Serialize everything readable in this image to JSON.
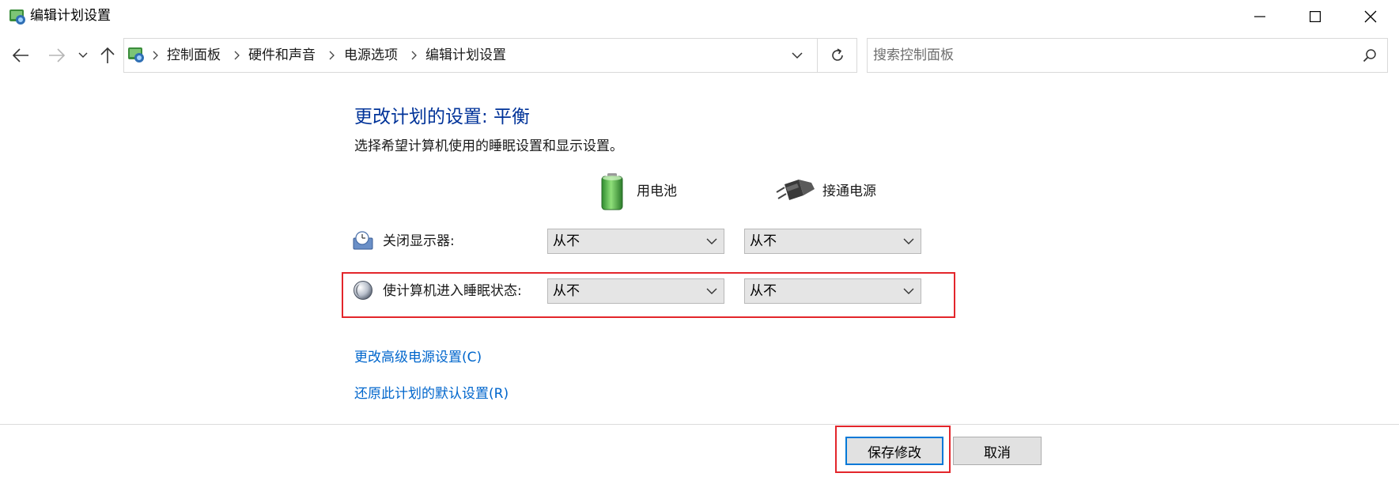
{
  "window": {
    "title": "编辑计划设置"
  },
  "nav": {
    "breadcrumbs": [
      "控制面板",
      "硬件和声音",
      "电源选项",
      "编辑计划设置"
    ]
  },
  "search": {
    "placeholder": "搜索控制面板"
  },
  "main": {
    "title": "更改计划的设置: 平衡",
    "subtitle": "选择希望计算机使用的睡眠设置和显示设置。",
    "columns": {
      "battery": "用电池",
      "plugged_in": "接通电源"
    },
    "rows": [
      {
        "label": "关闭显示器:",
        "battery_value": "从不",
        "plugged_value": "从不"
      },
      {
        "label": "使计算机进入睡眠状态:",
        "battery_value": "从不",
        "plugged_value": "从不"
      }
    ],
    "links": {
      "advanced": "更改高级电源设置(C)",
      "restore": "还原此计划的默认设置(R)"
    }
  },
  "footer": {
    "save_label": "保存修改",
    "cancel_label": "取消"
  },
  "colors": {
    "title_blue": "#003399",
    "link_blue": "#0066cc",
    "highlight_red": "#e3262b",
    "focus_blue": "#0078d7"
  }
}
